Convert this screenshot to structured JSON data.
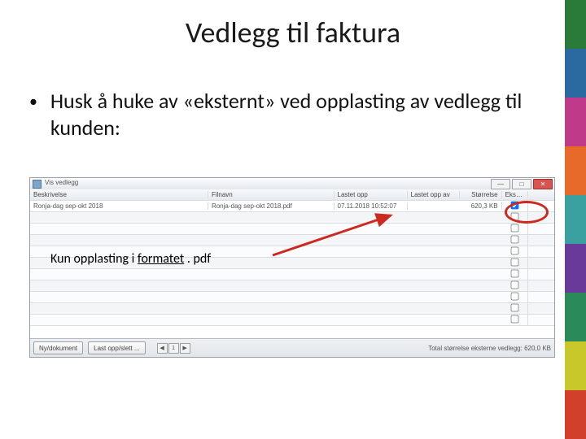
{
  "title": "Vedlegg til faktura",
  "bullet": "Husk å huke av «eksternt» ved opplasting av vedlegg til kunden:",
  "annotation": {
    "prefix": "Kun opplasting i ",
    "underlined": "formatet",
    "suffix": " . pdf"
  },
  "app": {
    "window_title": "Vis vedlegg",
    "columns": {
      "description": "Beskrivelse",
      "filename": "Filnavn",
      "uploaded_at": "Lastet opp",
      "uploaded_by": "Lastet opp av",
      "size": "Størrelse",
      "external": "Eksternt"
    },
    "rows": [
      {
        "description": "Ronja-dag sep-okt 2018",
        "filename": "Ronja-dag sep-okt 2018.pdf",
        "uploaded_at": "07.11.2018 10:52:07",
        "uploaded_by": "",
        "size": "620,3 KB",
        "external": true
      }
    ],
    "blank_rows": 10,
    "footer": {
      "btn_new": "Ny/dokument",
      "btn_delete": "Last opp/slett ...",
      "status_label": "Total størrelse eksterne vedlegg:",
      "status_value": "620,0 KB"
    },
    "win_buttons": {
      "min": "—",
      "max": "□",
      "close": "✕"
    },
    "pager": {
      "prev": "◀",
      "page": "1",
      "next": "▶"
    }
  }
}
